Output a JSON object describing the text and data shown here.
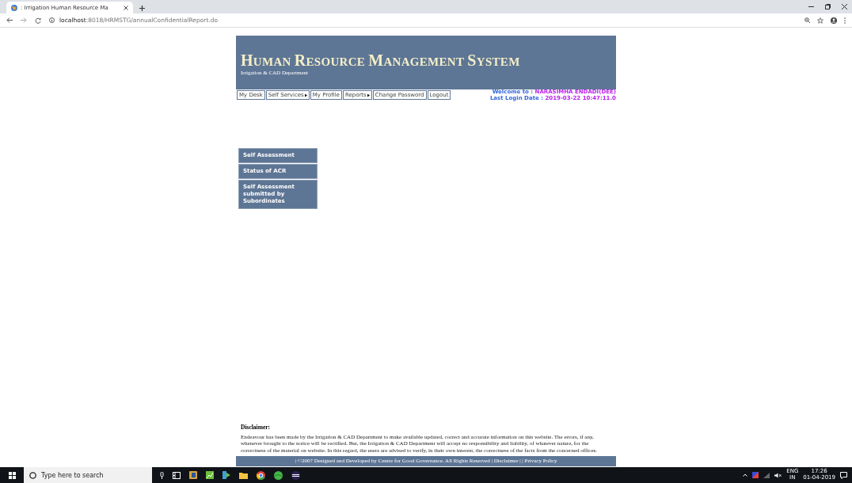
{
  "browser": {
    "tab_title": ": Irrigation Human Resource Ma",
    "url": "**localhost**:8018/HRMSTG/annualConfidentialReport.do"
  },
  "header": {
    "title": "HUMAN RESOURCE MANAGEMENT SYSTEM",
    "subtitle": "Irrigation & CAD Department"
  },
  "nav": [
    {
      "label": "My Desk",
      "has_submenu": false
    },
    {
      "label": "Self Services",
      "has_submenu": true
    },
    {
      "label": "My Profile",
      "has_submenu": false
    },
    {
      "label": "Reports",
      "has_submenu": true
    },
    {
      "label": "Change Password",
      "has_submenu": false
    },
    {
      "label": "Logout",
      "has_submenu": false
    }
  ],
  "user": {
    "welcome_label": "Welcome to : ",
    "name": "NARASIMHA ENDADI(DEE)",
    "login_label": "Last Login Date : ",
    "login_date": "2019-03-22 10:47:11.0"
  },
  "side_menu": [
    "Self Assessment",
    "Status of ACR",
    "Self Assessment submitted by Subordinates"
  ],
  "disclaimer": {
    "heading": "Disclaimer:",
    "text": "Endeavour has been made by the Irrigation & CAD Department to make available updated, correct and accurate information on this website. The errors, if any, whenever brought to the notice will be rectified. But, the Irrigation & CAD Department will accept no responsibility and liability, of whatever nature, for the correctness of the material on website. In this regard, the users are advised to verify, in their own interest, the correctness of the facts from the concerned offices."
  },
  "footer": "| ©2007 Designed and Developed by Centre for Good Governance. All Rights Reserved | Disclaimer | | Privacy Policy",
  "taskbar": {
    "search_placeholder": "Type here to search",
    "language": "ENG",
    "region": "IN",
    "time": "17:26",
    "date": "01-04-2019"
  }
}
